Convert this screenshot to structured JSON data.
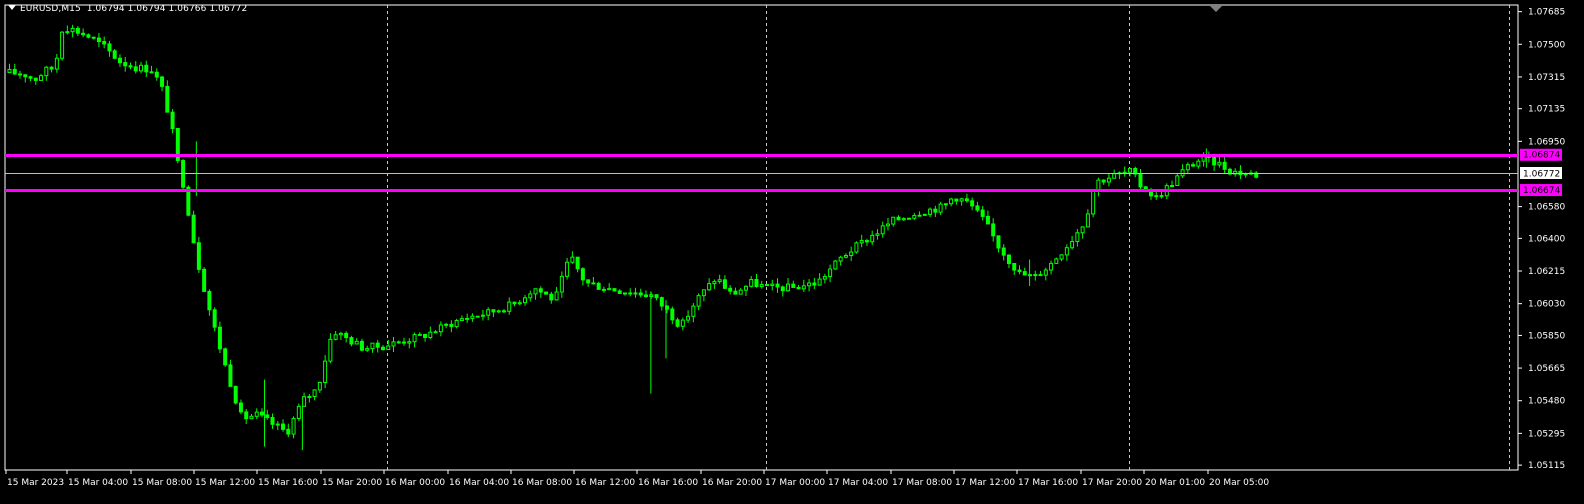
{
  "header": {
    "symbol": "EURUSD,M15",
    "ohlc": "1.06794 1.06794 1.06766 1.06772"
  },
  "colors": {
    "background": "#000000",
    "frame": "#ffffff",
    "candle": "#00ff00",
    "hline": "#ff00ff",
    "bid_line": "#c0c0c0",
    "axis_text": "#ffffff"
  },
  "icons": [
    "dropdown-triangle-icon",
    "shift-marker-icon"
  ],
  "chart_data": {
    "type": "candlestick",
    "symbol": "EURUSD",
    "timeframe": "M15",
    "title": "EURUSD,M15",
    "ylim": [
      1.0511,
      1.077
    ],
    "price_labels": [
      "1.07685",
      "1.07500",
      "1.07315",
      "1.07135",
      "1.06950",
      "1.06874",
      "1.06772",
      "1.06674",
      "1.06580",
      "1.06400",
      "1.06215",
      "1.06030",
      "1.05850",
      "1.05665",
      "1.05480",
      "1.05295",
      "1.05115"
    ],
    "y_ticks": [
      "1.07685",
      "1.07500",
      "1.07315",
      "1.07135",
      "1.06950",
      "1.06580",
      "1.06400",
      "1.06215",
      "1.06030",
      "1.05850",
      "1.05665",
      "1.05480",
      "1.05295",
      "1.05115"
    ],
    "x_labels": [
      "15 Mar 2023",
      "15 Mar 04:00",
      "15 Mar 08:00",
      "15 Mar 12:00",
      "15 Mar 16:00",
      "15 Mar 20:00",
      "16 Mar 00:00",
      "16 Mar 04:00",
      "16 Mar 08:00",
      "16 Mar 12:00",
      "16 Mar 16:00",
      "16 Mar 20:00",
      "17 Mar 00:00",
      "17 Mar 04:00",
      "17 Mar 08:00",
      "17 Mar 12:00",
      "17 Mar 16:00",
      "17 Mar 20:00",
      "20 Mar 01:00",
      "20 Mar 05:00"
    ],
    "horizontal_lines": [
      {
        "price": 1.06874,
        "label": "1.06874",
        "color": "#ff00ff"
      },
      {
        "price": 1.06674,
        "label": "1.06674",
        "color": "#ff00ff"
      }
    ],
    "bid": {
      "price": 1.06772,
      "label": "1.06772"
    },
    "vertical_dividers": [
      "16 Mar 00:00",
      "17 Mar 00:00",
      "20 Mar 00:00"
    ],
    "path": [
      [
        0,
        1.0734
      ],
      [
        0.03,
        1.0733
      ],
      [
        0.05,
        1.073
      ],
      [
        0.07,
        1.0735
      ],
      [
        0.09,
        1.0737
      ],
      [
        0.105,
        1.076
      ],
      [
        0.13,
        1.0758
      ],
      [
        0.16,
        1.0754
      ],
      [
        0.19,
        1.0748
      ],
      [
        0.22,
        1.074
      ],
      [
        0.25,
        1.0737
      ],
      [
        0.28,
        1.0736
      ],
      [
        0.3,
        1.0727
      ],
      [
        0.32,
        1.0705
      ],
      [
        0.335,
        1.068
      ],
      [
        0.345,
        1.067
      ],
      [
        0.37,
        1.063
      ],
      [
        0.4,
        1.0595
      ],
      [
        0.43,
        1.0565
      ],
      [
        0.46,
        1.0538
      ],
      [
        0.49,
        1.054
      ],
      [
        0.52,
        1.0535
      ],
      [
        0.55,
        1.053
      ],
      [
        0.58,
        1.0548
      ],
      [
        0.61,
        1.0555
      ],
      [
        0.64,
        1.0588
      ],
      [
        0.67,
        1.0583
      ],
      [
        0.7,
        1.0578
      ],
      [
        0.74,
        1.0579
      ],
      [
        0.78,
        1.0582
      ],
      [
        0.82,
        1.0585
      ],
      [
        0.86,
        1.059
      ],
      [
        0.9,
        1.0595
      ],
      [
        0.95,
        1.0598
      ],
      [
        1.0,
        1.0603
      ],
      [
        1.04,
        1.0612
      ],
      [
        1.08,
        1.0605
      ],
      [
        1.11,
        1.063
      ],
      [
        1.14,
        1.0615
      ],
      [
        1.18,
        1.0612
      ],
      [
        1.22,
        1.061
      ],
      [
        1.27,
        1.0608
      ],
      [
        1.3,
        1.06
      ],
      [
        1.33,
        1.059
      ],
      [
        1.36,
        1.0605
      ],
      [
        1.4,
        1.0618
      ],
      [
        1.43,
        1.0608
      ],
      [
        1.47,
        1.0615
      ],
      [
        1.5,
        1.0612
      ],
      [
        1.55,
        1.0612
      ],
      [
        1.6,
        1.0615
      ],
      [
        1.65,
        1.063
      ],
      [
        1.7,
        1.064
      ],
      [
        1.75,
        1.065
      ],
      [
        1.8,
        1.0655
      ],
      [
        1.85,
        1.0658
      ],
      [
        1.87,
        1.0664
      ],
      [
        1.9,
        1.066
      ],
      [
        1.93,
        1.065
      ],
      [
        1.96,
        1.0635
      ],
      [
        2.0,
        1.062
      ],
      [
        2.03,
        1.0618
      ],
      [
        2.06,
        1.0625
      ],
      [
        2.1,
        1.0638
      ],
      [
        2.13,
        1.065
      ],
      [
        2.15,
        1.0672
      ],
      [
        2.18,
        1.0675
      ],
      [
        2.22,
        1.0678
      ],
      [
        2.24,
        1.067
      ],
      [
        2.27,
        1.0663
      ],
      [
        2.3,
        1.0671
      ],
      [
        2.33,
        1.068
      ],
      [
        2.36,
        1.0685
      ],
      [
        2.39,
        1.0683
      ],
      [
        2.42,
        1.0678
      ],
      [
        2.47,
        1.0676
      ]
    ],
    "spikes": [
      [
        0.37,
        1.0695,
        1.0664
      ],
      [
        0.505,
        1.0522,
        1.056
      ],
      [
        0.58,
        1.052,
        1.0545
      ],
      [
        1.27,
        1.0552,
        1.061
      ],
      [
        1.3,
        1.0572,
        1.0605
      ],
      [
        2.02,
        1.0613,
        1.0628
      ],
      [
        2.37,
        1.068,
        1.0691
      ]
    ]
  }
}
